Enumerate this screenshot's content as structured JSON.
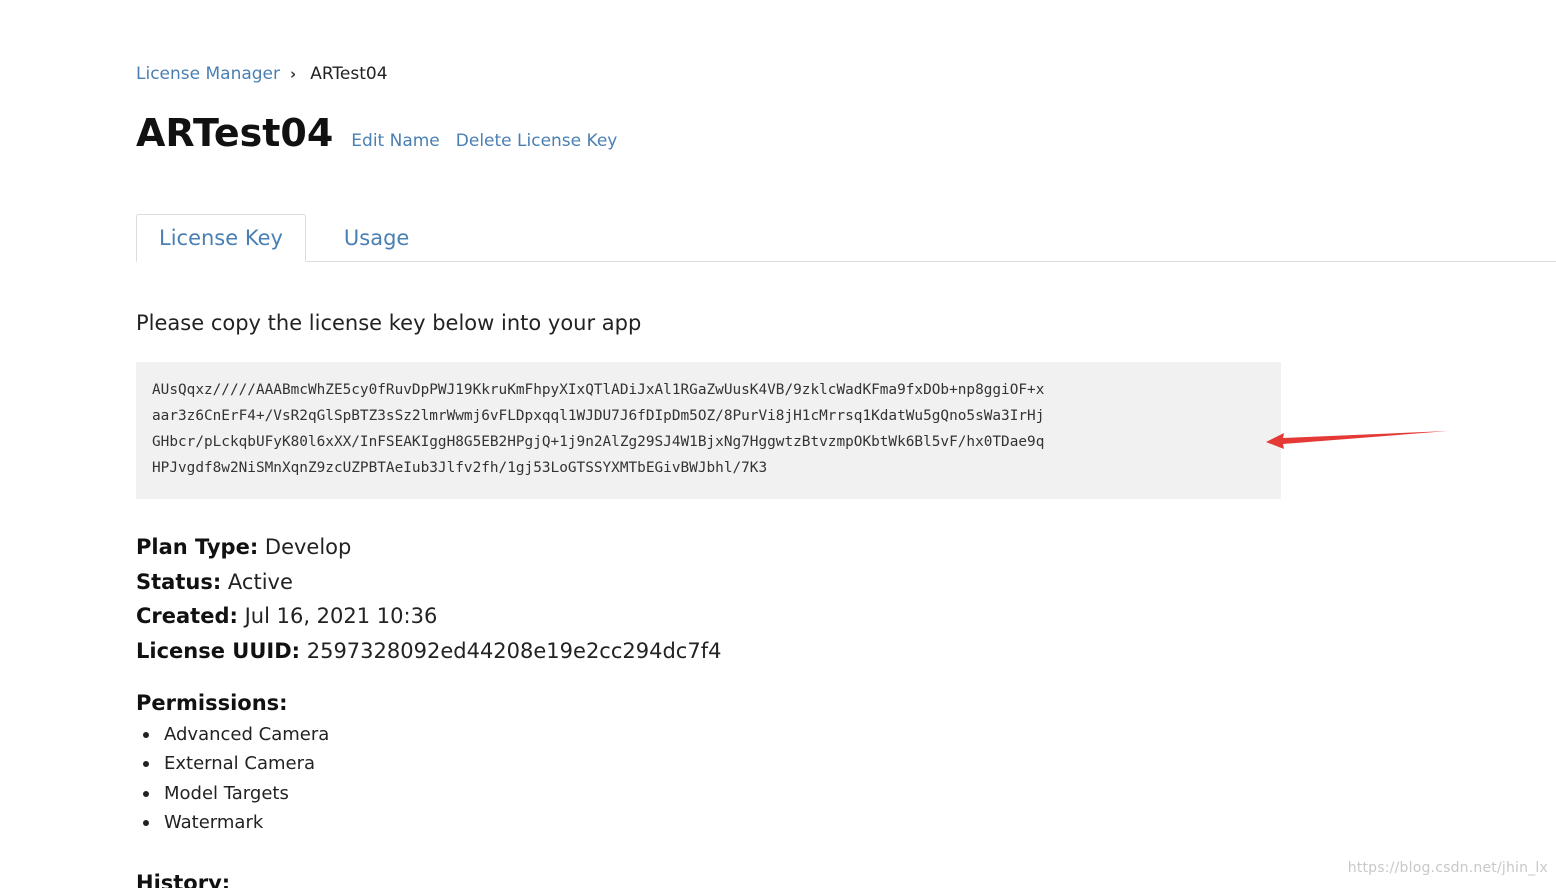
{
  "breadcrumb": {
    "root": "License Manager",
    "separator": "›",
    "current": "ARTest04"
  },
  "header": {
    "title": "ARTest04",
    "edit_name": "Edit Name",
    "delete_key": "Delete License Key"
  },
  "tabs": [
    {
      "label": "License Key",
      "active": true
    },
    {
      "label": "Usage",
      "active": false
    }
  ],
  "instruction": "Please copy the license key below into your app",
  "license_key": {
    "lines": [
      "AUsQqxz/////AAABmcWhZE5cy0fRuvDpPWJ19KkruKmFhpyXIxQTlADiJxAl1RGaZwUusK4VB/9zklcWadKFma9fxDOb+np8ggiOF+x",
      "aar3z6CnErF4+/VsR2qGlSpBTZ3sSz2lmrWwmj6vFLDpxqql1WJDU7J6fDIpDm5OZ/8PurVi8jH1cMrrsq1KdatWu5gQno5sWa3IrHj",
      "GHbcr/pLckqbUFyK80l6xXX/InFSEAKIggH8G5EB2HPgjQ+1j9n2AlZg29SJ4W1BjxNg7HggwtzBtvzmpOKbtWk6Bl5vF/hx0TDae9q",
      "HPJvgdf8w2NiSMnXqnZ9zcUZPBTAeIub3Jlfv2fh/1gj53LoGTSSYXMTbEGivBWJbhl/7K3"
    ],
    "arrow_color": "#e53935"
  },
  "details": {
    "plan_type_label": "Plan Type:",
    "plan_type": "Develop",
    "status_label": "Status:",
    "status": "Active",
    "created_label": "Created:",
    "created": "Jul 16, 2021 10:36",
    "uuid_label": "License UUID:",
    "uuid": "2597328092ed44208e19e2cc294dc7f4"
  },
  "permissions": {
    "title": "Permissions:",
    "items": [
      "Advanced Camera",
      "External Camera",
      "Model Targets",
      "Watermark"
    ]
  },
  "history": {
    "title": "History:"
  },
  "watermark": "https://blog.csdn.net/jhin_lx"
}
